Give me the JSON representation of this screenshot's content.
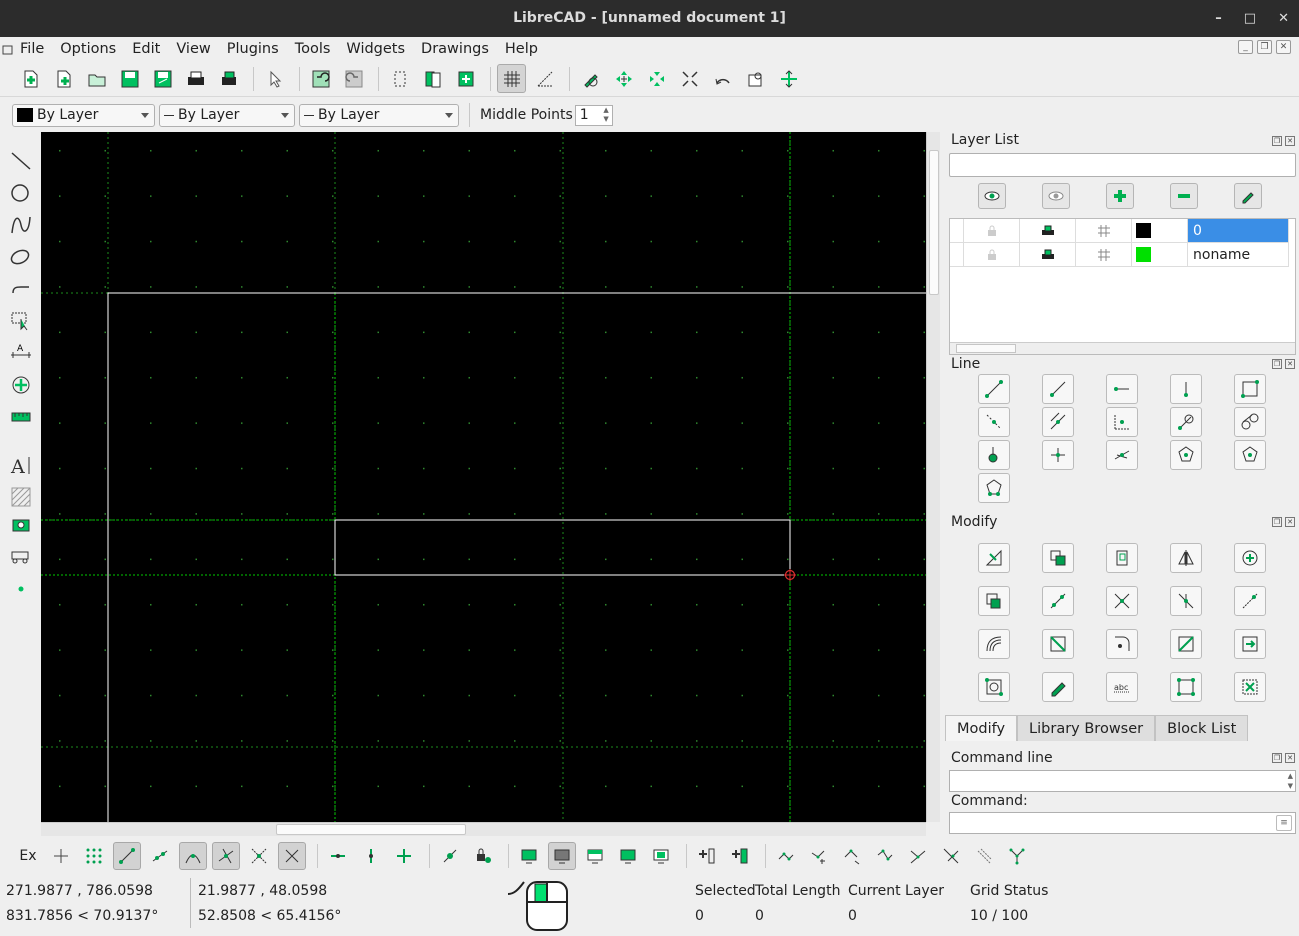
{
  "window": {
    "title": "LibreCAD - [unnamed document 1]",
    "min": "–",
    "max": "□",
    "close": "✕"
  },
  "menu": [
    "File",
    "Options",
    "Edit",
    "View",
    "Plugins",
    "Tools",
    "Widgets",
    "Drawings",
    "Help"
  ],
  "pen": {
    "color": "By Layer",
    "linetype": "By Layer",
    "width": "By Layer",
    "middle_label": "Middle Points",
    "middle_value": "1"
  },
  "layers": {
    "title": "Layer List",
    "rows": [
      {
        "name": "0",
        "color": "#000000",
        "selected": true
      },
      {
        "name": "noname",
        "color": "#00e000",
        "selected": false
      }
    ]
  },
  "line_panel": {
    "title": "Line"
  },
  "modify_panel": {
    "title": "Modify"
  },
  "tabs": [
    "Modify",
    "Library Browser",
    "Block List"
  ],
  "command": {
    "title": "Command line",
    "label": "Command:"
  },
  "snap": {
    "ex": "Ex"
  },
  "status": {
    "abs1": "271.9877 , 786.0598",
    "abs2": "831.7856 < 70.9137°",
    "rel1": "21.9877 , 48.0598",
    "rel2": "52.8508 < 65.4156°",
    "selected_label": "Selected",
    "selected_value": "0",
    "length_label": "Total Length",
    "length_value": "0",
    "layer_label": "Current Layer",
    "layer_value": "0",
    "grid_label": "Grid Status",
    "grid_value": "10 / 100"
  },
  "colors": {
    "accent": "#00c060",
    "selection": "#3a8ee6",
    "grid": "#00cc00"
  }
}
